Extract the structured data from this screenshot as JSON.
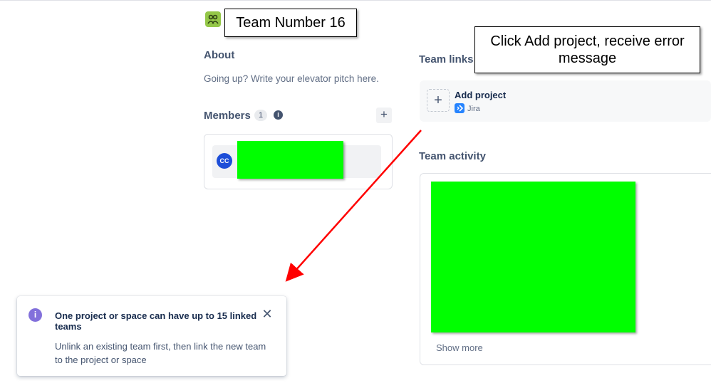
{
  "header": {
    "team_name": "Team Number 16",
    "team_icon": "team-people-icon",
    "brand_color": "#94c748"
  },
  "annotation": {
    "note": "Click Add project, receive error message",
    "arrow_color": "#ff0000"
  },
  "about": {
    "heading": "About",
    "placeholder": "Going up? Write your elevator pitch here."
  },
  "members": {
    "heading": "Members",
    "count": "1",
    "info_icon": "info-icon",
    "add_icon": "plus-icon",
    "items": [
      {
        "initials": "CC",
        "name_redacted": true
      }
    ]
  },
  "team_links": {
    "heading": "Team links",
    "add_label": "Add project",
    "product": "Jira"
  },
  "team_activity": {
    "heading": "Team activity",
    "show_more": "Show more"
  },
  "flag": {
    "icon": "info-icon",
    "title": "One project or space can have up to 15 linked teams",
    "body": "Unlink an existing team first, then link the new team to the project or space",
    "close_icon": "close-icon",
    "accent": "#8270db"
  },
  "redaction_color": "#00ff00"
}
